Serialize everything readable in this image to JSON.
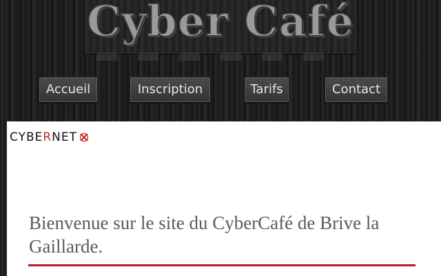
{
  "header": {
    "title": "Cyber Café"
  },
  "nav": {
    "items": [
      {
        "label": "Accueil"
      },
      {
        "label": "Inscription"
      },
      {
        "label": "Tarifs"
      },
      {
        "label": "Contact"
      }
    ]
  },
  "logo": {
    "part1": "CYBE",
    "part2": "R",
    "part3": "NET"
  },
  "main": {
    "welcome_text": "Bienvenue sur le site du CyberCafé de Brive la Gaillarde."
  },
  "colors": {
    "accent": "#b71c1c",
    "nav_bg": "#3f3f3f",
    "content_bg": "#ffffff"
  }
}
